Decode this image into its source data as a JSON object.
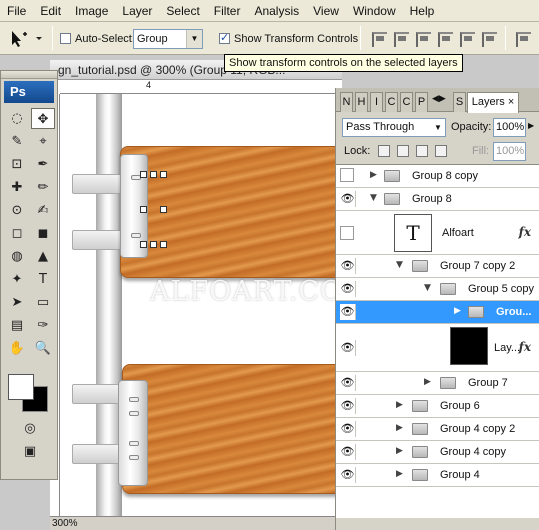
{
  "menu": [
    "File",
    "Edit",
    "Image",
    "Layer",
    "Select",
    "Filter",
    "Analysis",
    "View",
    "Window",
    "Help"
  ],
  "options": {
    "auto_select_label": "Auto-Select:",
    "auto_select_value": "Group",
    "show_transform_label": "Show Transform Controls"
  },
  "tooltip": "Show transform controls on the selected layers",
  "document": {
    "title": "gn_tutorial.psd @ 300% (Group 11, RGB...",
    "ruler_mark": "4",
    "zoom": "300%",
    "watermark": "ALFOART.COM"
  },
  "toolbox": {
    "logo": "Ps",
    "tools": [
      "◌",
      "✥",
      "✎",
      "⌖",
      "⊡",
      "✒",
      "✚",
      "✏",
      "⊙",
      "✍",
      "◻",
      "◼",
      "◍",
      "▲",
      "✦",
      "T",
      "➤",
      "▭",
      "▤",
      "✑",
      "✋",
      "🔍"
    ]
  },
  "layers": {
    "tabs": [
      "N",
      "H",
      "I",
      "C",
      "C",
      "P",
      "S",
      "Layers"
    ],
    "blend_mode": "Pass Through",
    "opacity_label": "Opacity:",
    "opacity_value": "100%",
    "lock_label": "Lock:",
    "fill_label": "Fill:",
    "fill_value": "100%",
    "rows": [
      {
        "name": "Group 8 copy",
        "visible": false,
        "expanded": false
      },
      {
        "name": "Group 8",
        "visible": true,
        "expanded": true
      },
      {
        "name": "Alfoart",
        "visible": false,
        "thumb": "T",
        "fx": "fx"
      },
      {
        "name": "Group 7 copy 2",
        "visible": true,
        "expanded": true
      },
      {
        "name": "Group 5 copy",
        "visible": true,
        "expanded": true
      },
      {
        "name": "Grou...",
        "visible": true,
        "expanded": false,
        "selected": true
      },
      {
        "name": "Lay...",
        "visible": true,
        "fx": "fx"
      },
      {
        "name": "Group 7",
        "visible": true,
        "expanded": false
      },
      {
        "name": "Group 6",
        "visible": true,
        "expanded": false
      },
      {
        "name": "Group 4 copy 2",
        "visible": true,
        "expanded": false
      },
      {
        "name": "Group 4 copy",
        "visible": true,
        "expanded": false
      },
      {
        "name": "Group 4",
        "visible": true,
        "expanded": false
      }
    ]
  }
}
